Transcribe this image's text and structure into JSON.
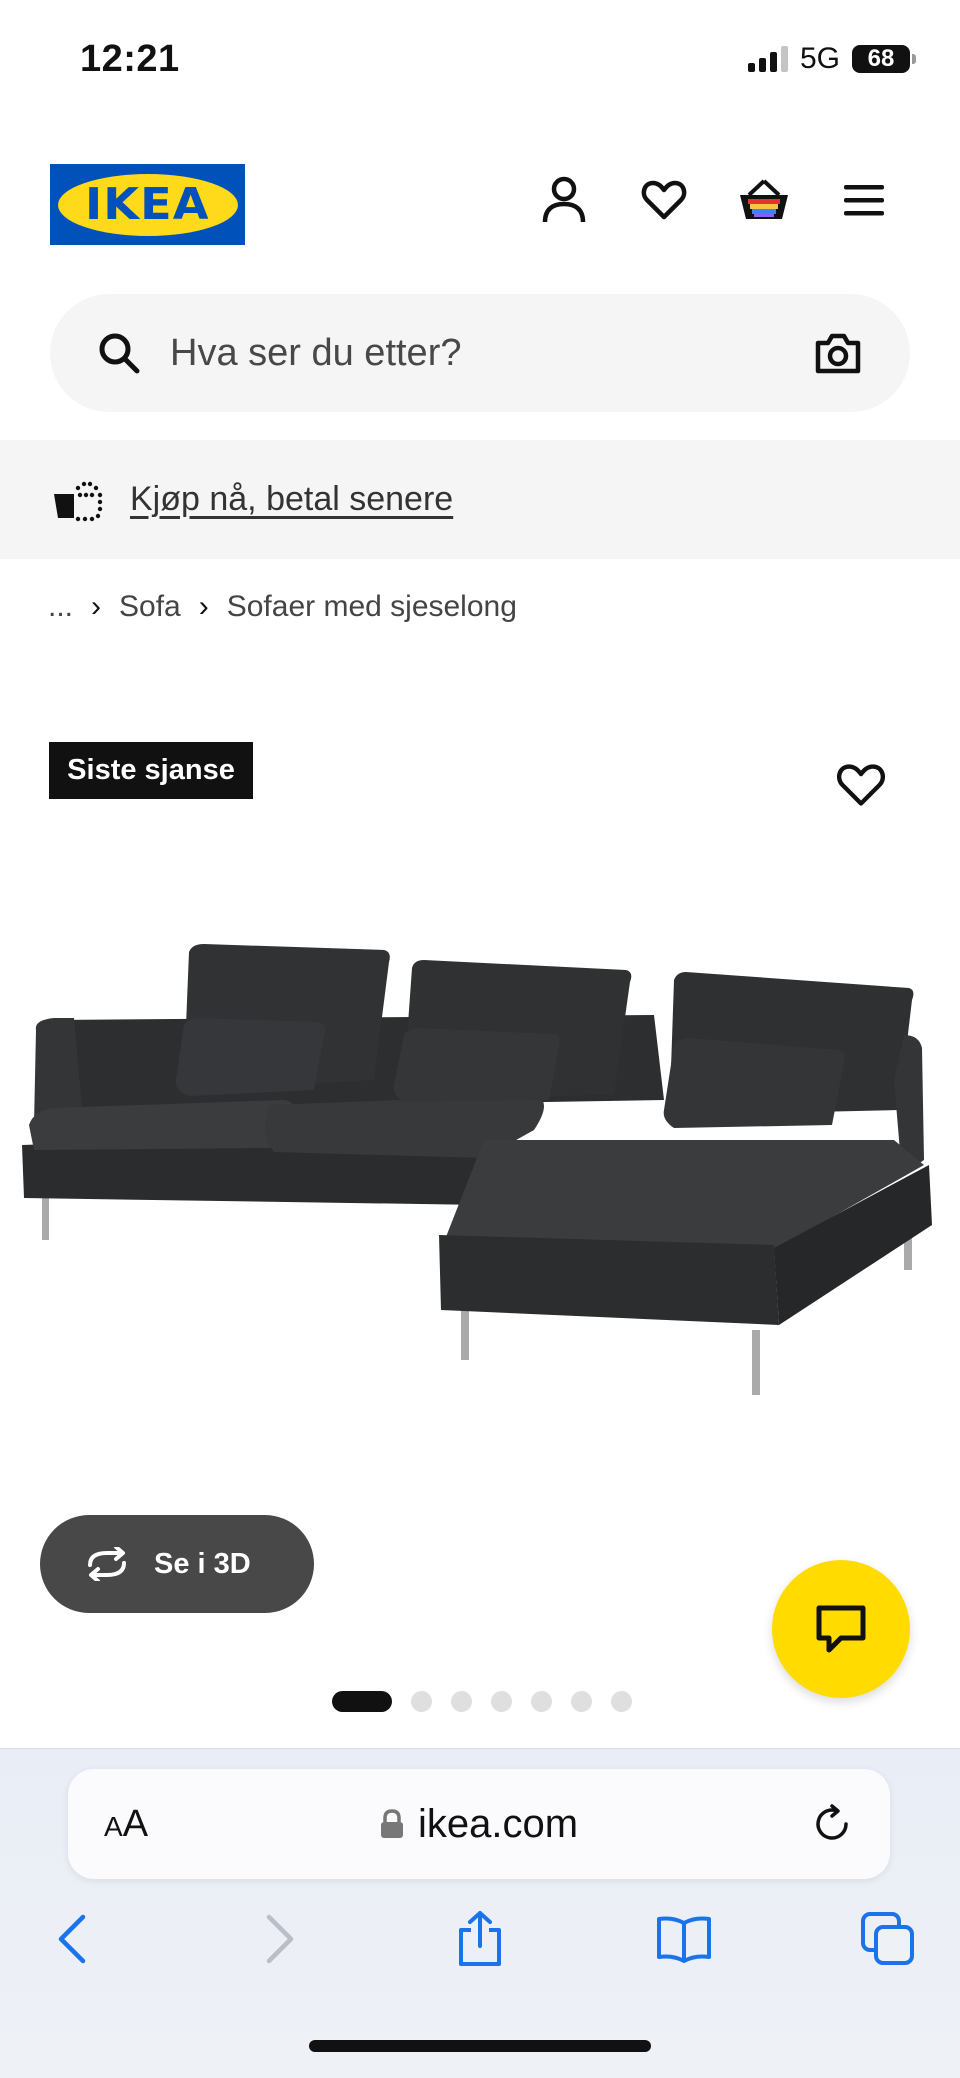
{
  "status": {
    "time": "12:21",
    "network": "5G",
    "battery": "68"
  },
  "header": {
    "logo_text": "IKEA"
  },
  "search": {
    "placeholder": "Hva ser du etter?"
  },
  "promo": {
    "text": "Kjøp nå, betal senere"
  },
  "breadcrumb": {
    "ellipsis": "...",
    "items": [
      "Sofa",
      "Sofaer med sjeselong"
    ]
  },
  "product": {
    "badge": "Siste sjanse",
    "view_3d_label": "Se i 3D",
    "image_count": 7,
    "active_image": 1
  },
  "browser": {
    "text_size_label": "AA",
    "url": "ikea.com"
  },
  "colors": {
    "ikea_blue": "#0051ba",
    "ikea_yellow": "#ffdb00",
    "dark_button": "#484848",
    "ios_blue": "#1a73e8"
  }
}
